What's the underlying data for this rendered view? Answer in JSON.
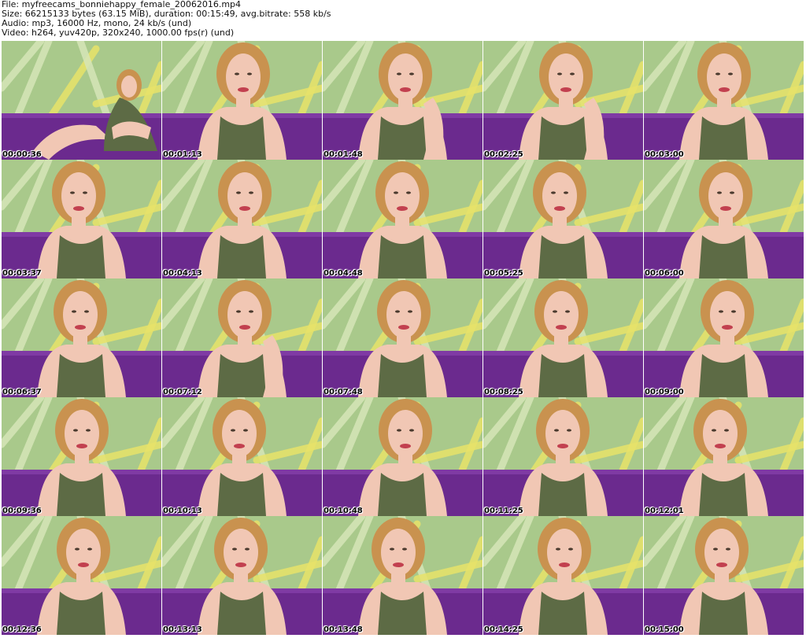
{
  "header": {
    "file_line": "File: myfreecams_bonniehappy_female_20062016.mp4",
    "size_line": "Size: 66215133 bytes (63.15 MiB), duration: 00:15:49, avg.bitrate: 558 kb/s",
    "audio_line": "Audio: mp3, 16000 Hz, mono, 24 kb/s (und)",
    "video_line": "Video: h264, yuv420p, 320x240, 1000.00 fps(r) (und)"
  },
  "colors": {
    "wall_green": "#a9c98b",
    "leaf_yellow": "#e8e36a",
    "sofa_purple": "#6b2a8e",
    "skin": "#f1c7b4",
    "hair": "#c9924f",
    "top_olive": "#5d6b45"
  },
  "frames": [
    {
      "timestamp": "00:00:36",
      "pose": "seated"
    },
    {
      "timestamp": "00:01:13",
      "pose": "close"
    },
    {
      "timestamp": "00:01:48",
      "pose": "hand"
    },
    {
      "timestamp": "00:02:25",
      "pose": "hand"
    },
    {
      "timestamp": "00:03:00",
      "pose": "close"
    },
    {
      "timestamp": "00:03:37",
      "pose": "close"
    },
    {
      "timestamp": "00:04:13",
      "pose": "close"
    },
    {
      "timestamp": "00:04:48",
      "pose": "close"
    },
    {
      "timestamp": "00:05:25",
      "pose": "close"
    },
    {
      "timestamp": "00:06:00",
      "pose": "close"
    },
    {
      "timestamp": "00:06:37",
      "pose": "close"
    },
    {
      "timestamp": "00:07:12",
      "pose": "hand"
    },
    {
      "timestamp": "00:07:48",
      "pose": "close"
    },
    {
      "timestamp": "00:08:25",
      "pose": "close"
    },
    {
      "timestamp": "00:09:00",
      "pose": "close"
    },
    {
      "timestamp": "00:09:36",
      "pose": "close"
    },
    {
      "timestamp": "00:10:13",
      "pose": "close"
    },
    {
      "timestamp": "00:10:48",
      "pose": "close"
    },
    {
      "timestamp": "00:11:25",
      "pose": "close"
    },
    {
      "timestamp": "00:12:01",
      "pose": "close"
    },
    {
      "timestamp": "00:12:36",
      "pose": "close"
    },
    {
      "timestamp": "00:13:13",
      "pose": "close"
    },
    {
      "timestamp": "00:13:48",
      "pose": "close"
    },
    {
      "timestamp": "00:14:25",
      "pose": "close"
    },
    {
      "timestamp": "00:15:00",
      "pose": "close"
    }
  ]
}
